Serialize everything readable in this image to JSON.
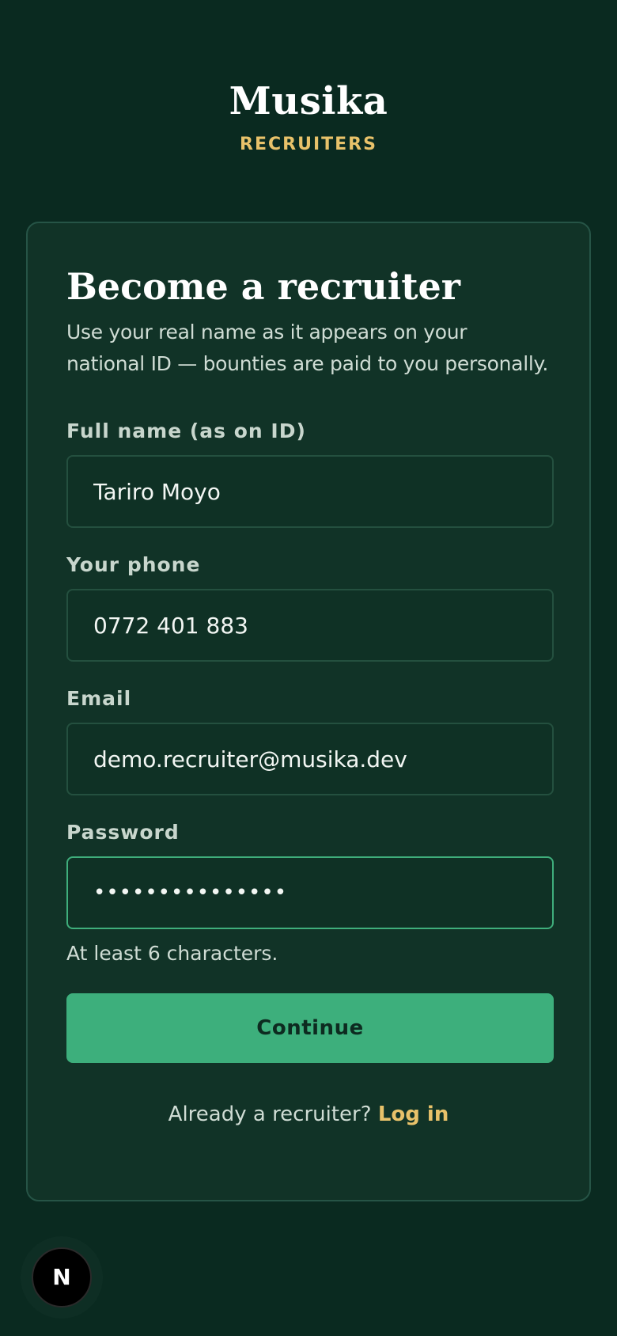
{
  "brand": {
    "name": "Musika",
    "subtitle": "RECRUITERS"
  },
  "card": {
    "title": "Become a recruiter",
    "description": "Use your real name as it appears on your national ID — bounties are paid to you personally.",
    "fields": {
      "full_name": {
        "label": "Full name (as on ID)",
        "value": "Tariro Moyo"
      },
      "phone": {
        "label": "Your phone",
        "value": "0772 401 883"
      },
      "email": {
        "label": "Email",
        "value": "demo.recruiter@musika.dev"
      },
      "password": {
        "label": "Password",
        "value": "•••••••••••••••",
        "hint": "At least 6 characters."
      }
    },
    "continue_label": "Continue",
    "login_prompt": "Already a recruiter?",
    "login_link": "Log in"
  },
  "dev_badge": {
    "letter": "N",
    "icon": "nextjs-logo-icon"
  },
  "colors": {
    "background": "#0a2a20",
    "card": "#113327",
    "accent_green": "#3daf7c",
    "accent_gold": "#e8c26a"
  }
}
